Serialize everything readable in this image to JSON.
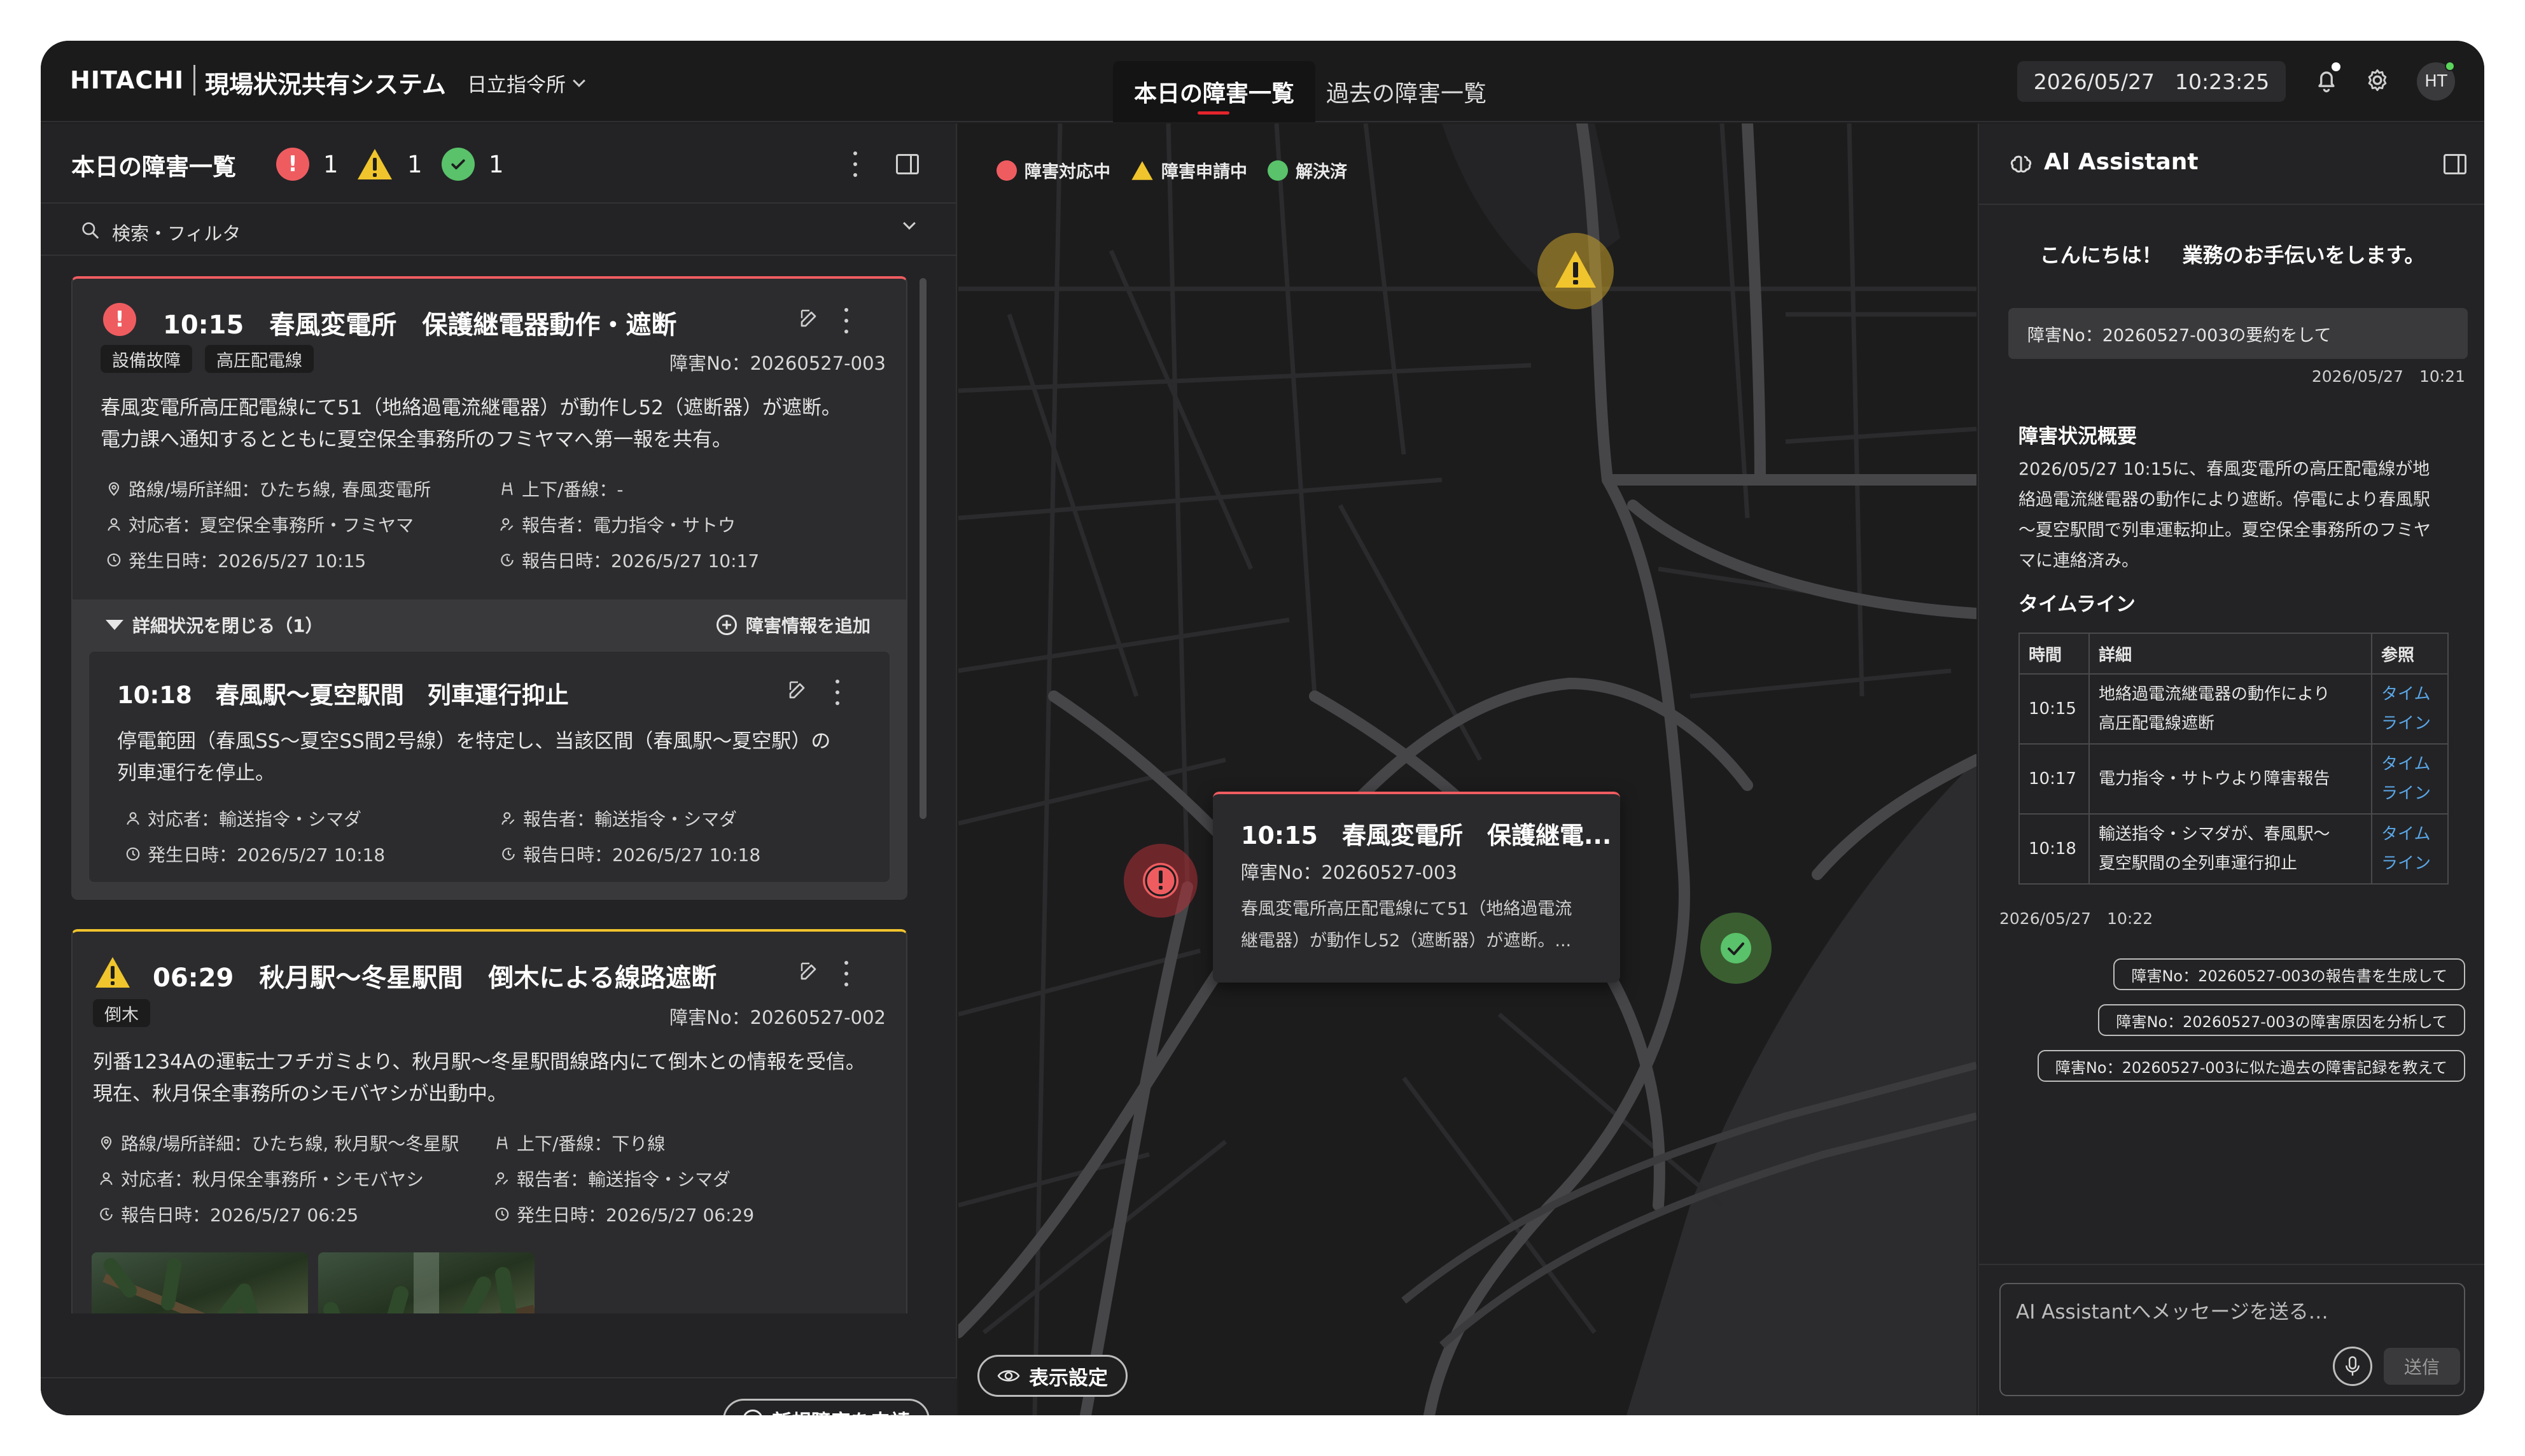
{
  "header": {
    "brand": "HITACHI",
    "app_title": "現場状況共有システム",
    "site": "日立指令所",
    "tabs": [
      {
        "label": "本日の障害一覧",
        "active": true
      },
      {
        "label": "過去の障害一覧",
        "active": false
      }
    ],
    "date": "2026/05/27",
    "time": "10:23:25",
    "avatar_initials": "HT"
  },
  "left_panel": {
    "title": "本日の障害一覧",
    "counts": {
      "red": "1",
      "yellow": "1",
      "green": "1"
    },
    "search_label": "検索・フィルタ",
    "cards": [
      {
        "status": "red",
        "time": "10:15",
        "title": "10:15　春風変電所　保護継電器動作・遮断",
        "tags": [
          "設備故障",
          "高圧配電線"
        ],
        "incident_no": "障害No：20260527-003",
        "body_lines": [
          "春風変電所高圧配電線にて51（地絡過電流継電器）が動作し52（遮断器）が遮断。",
          "電力課へ通知するとともに夏空保全事務所のフミヤマへ第一報を共有。"
        ],
        "location": "路線/場所詳細：ひたち線, 春風変電所",
        "direction": "上下/番線：-",
        "responder": "対応者：夏空保全事務所・フミヤマ",
        "reporter": "報告者：電力指令・サトウ",
        "occurred": "発生日時：2026/5/27 10:15",
        "reported": "報告日時：2026/5/27 10:17",
        "detail_toggle": "詳細状況を閉じる（1）",
        "add_label": "障害情報を追加",
        "sub": {
          "title": "10:18　春風駅〜夏空駅間　列車運行抑止",
          "body_lines": [
            "停電範囲（春風SS〜夏空SS間2号線）を特定し、当該区間（春風駅〜夏空駅）の",
            "列車運行を停止。"
          ],
          "responder": "対応者：輸送指令・シマダ",
          "reporter": "報告者：輸送指令・シマダ",
          "occurred": "発生日時：2026/5/27 10:18",
          "reported": "報告日時：2026/5/27 10:18"
        }
      },
      {
        "status": "yellow",
        "title": "06:29　秋月駅〜冬星駅間　倒木による線路遮断",
        "tags": [
          "倒木"
        ],
        "incident_no": "障害No：20260527-002",
        "body_lines": [
          "列番1234Aの運転士フチガミより、秋月駅〜冬星駅間線路内にて倒木との情報を受信。",
          "現在、秋月保全事務所のシモバヤシが出動中。"
        ],
        "location": "路線/場所詳細：ひたち線, 秋月駅〜冬星駅",
        "direction": "上下/番線：下り線",
        "responder": "対応者：秋月保全事務所・シモバヤシ",
        "reporter": "報告者：輸送指令・シマダ",
        "reported": "報告日時：2026/5/27 06:25",
        "occurred": "発生日時：2026/5/27 06:29"
      }
    ],
    "new_button": "新規障害を申請"
  },
  "map": {
    "legend": [
      "障害対応中",
      "障害申請中",
      "解決済"
    ],
    "popup": {
      "title": "10:15　春風変電所　保護継電...",
      "incident_no": "障害No：20260527-003",
      "body_lines": [
        "春風変電所高圧配電線にて51（地絡過電流",
        "継電器）が動作し52（遮断器）が遮断。..."
      ]
    },
    "display_button": "表示設定"
  },
  "ai": {
    "title": "AI Assistant",
    "greeting": "こんにちは！　業務のお手伝いをします。",
    "user_message": "障害No：20260527-003の要約をして",
    "user_message_time": "2026/05/27　10:21",
    "summary_heading": "障害状況概要",
    "summary_lines": [
      "2026/05/27 10:15に、春風変電所の高圧配電線が地",
      "絡過電流継電器の動作により遮断。停電により春風駅",
      "〜夏空駅間で列車運転抑止。夏空保全事務所のフミヤ",
      "マに連絡済み。"
    ],
    "timeline_heading": "タイムライン",
    "table_headers": [
      "時間",
      "詳細",
      "参照"
    ],
    "table_rows": [
      {
        "time": "10:15",
        "detail1": "地絡過電流継電器の動作により",
        "detail2": "高圧配電線遮断",
        "ref1": "タイム",
        "ref2": "ライン"
      },
      {
        "time": "10:17",
        "detail1": "電力指令・サトウより障害報告",
        "detail2": "",
        "ref1": "タイム",
        "ref2": "ライン"
      },
      {
        "time": "10:18",
        "detail1": "輸送指令・シマダが、春風駅〜",
        "detail2": "夏空駅間の全列車運行抑止",
        "ref1": "タイム",
        "ref2": "ライン"
      }
    ],
    "reply_time": "2026/05/27　10:22",
    "suggestions": [
      "障害No：20260527-003の報告書を生成して",
      "障害No：20260527-003の障害原因を分析して",
      "障害No：20260527-003に似た過去の障害記録を教えて"
    ],
    "input_placeholder": "AI Assistantへメッセージを送る…",
    "send_label": "送信"
  }
}
